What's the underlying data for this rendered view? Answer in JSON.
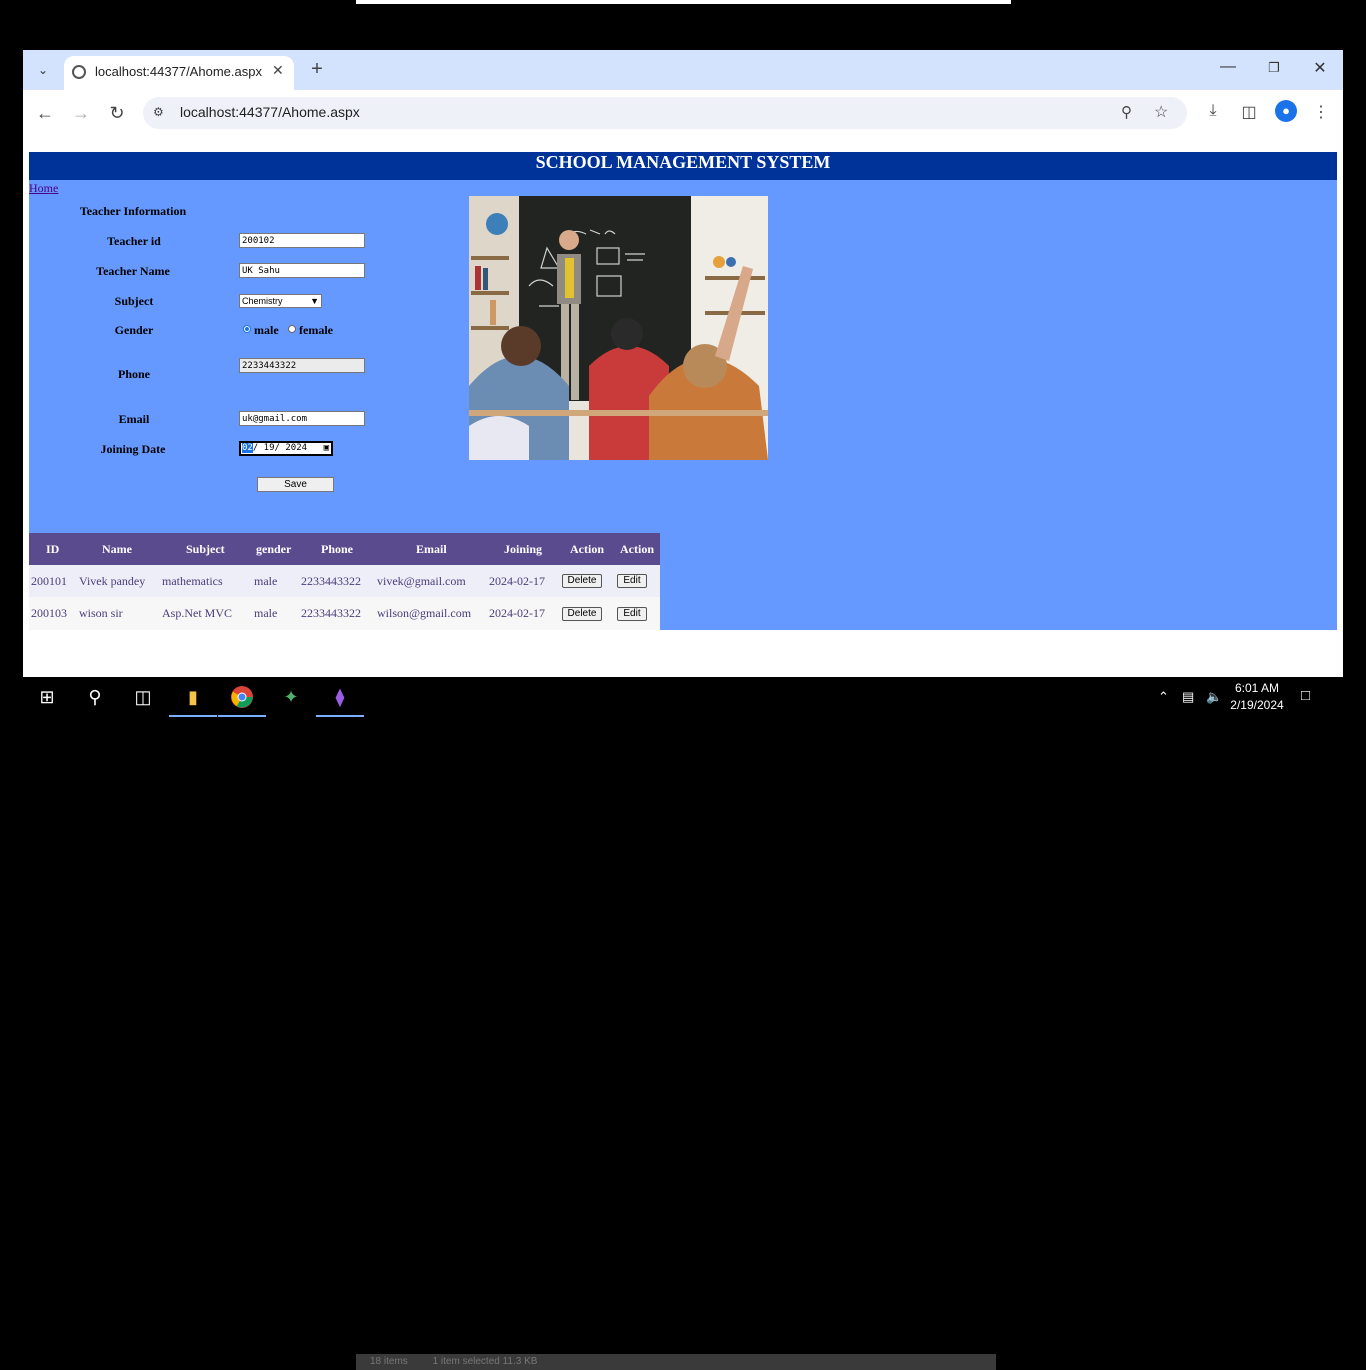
{
  "browser": {
    "tab_title": "localhost:44377/Ahome.aspx",
    "url": "localhost:44377/Ahome.aspx",
    "icons": {
      "tab_search": "chevron-down-icon",
      "new_tab": "plus-icon",
      "back": "back-arrow-icon",
      "forward": "forward-arrow-icon",
      "reload": "reload-icon",
      "zoom": "zoom-icon",
      "bookmark": "star-icon",
      "download": "download-icon",
      "side_panel": "side-panel-icon",
      "profile": "profile-icon",
      "menu": "kebab-menu-icon"
    }
  },
  "page": {
    "header": "SCHOOL MANAGEMENT SYSTEM",
    "home_link": "Home",
    "colors": {
      "header_bg": "#003399",
      "page_bg": "#6699ff",
      "grid_header_bg": "#5a4b8f"
    }
  },
  "form": {
    "title": "Teacher Information",
    "teacher_id_label": "Teacher id",
    "teacher_id_value": "200102",
    "teacher_name_label": "Teacher Name",
    "teacher_name_value": "UK Sahu",
    "subject_label": "Subject",
    "subject_value": "Chemistry",
    "gender_label": "Gender",
    "gender_options": [
      "male",
      "female"
    ],
    "gender_selected": "male",
    "phone_label": "Phone",
    "phone_value": "2233443322",
    "email_label": "Email",
    "email_value": "uk@gmail.com",
    "joining_label": "Joining Date",
    "joining_month": "02",
    "joining_rest": "/ 19/ 2024",
    "save_label": "Save"
  },
  "grid": {
    "headers": [
      "ID",
      "Name",
      "Subject",
      "gender",
      "Phone",
      "Email",
      "Joining",
      "Action",
      "Action"
    ],
    "rows": [
      {
        "id": "200101",
        "name": "Vivek pandey",
        "subject": "mathematics",
        "gender": "male",
        "phone": "2233443322",
        "email": "vivek@gmail.com",
        "joining": "2024-02-17",
        "delete": "Delete",
        "edit": "Edit"
      },
      {
        "id": "200103",
        "name": "wison sir",
        "subject": "Asp.Net MVC",
        "gender": "male",
        "phone": "2233443322",
        "email": "wilson@gmail.com",
        "joining": "2024-02-17",
        "delete": "Delete",
        "edit": "Edit"
      }
    ]
  },
  "explorer_status": {
    "items": "18 items",
    "selected": "1 item selected  11.3 KB"
  },
  "taskbar": {
    "apps": [
      "start-icon",
      "search-icon",
      "task-view-icon",
      "file-explorer-icon",
      "chrome-icon",
      "python-icon",
      "visual-studio-icon"
    ],
    "time": "6:01 AM",
    "date": "2/19/2024"
  }
}
